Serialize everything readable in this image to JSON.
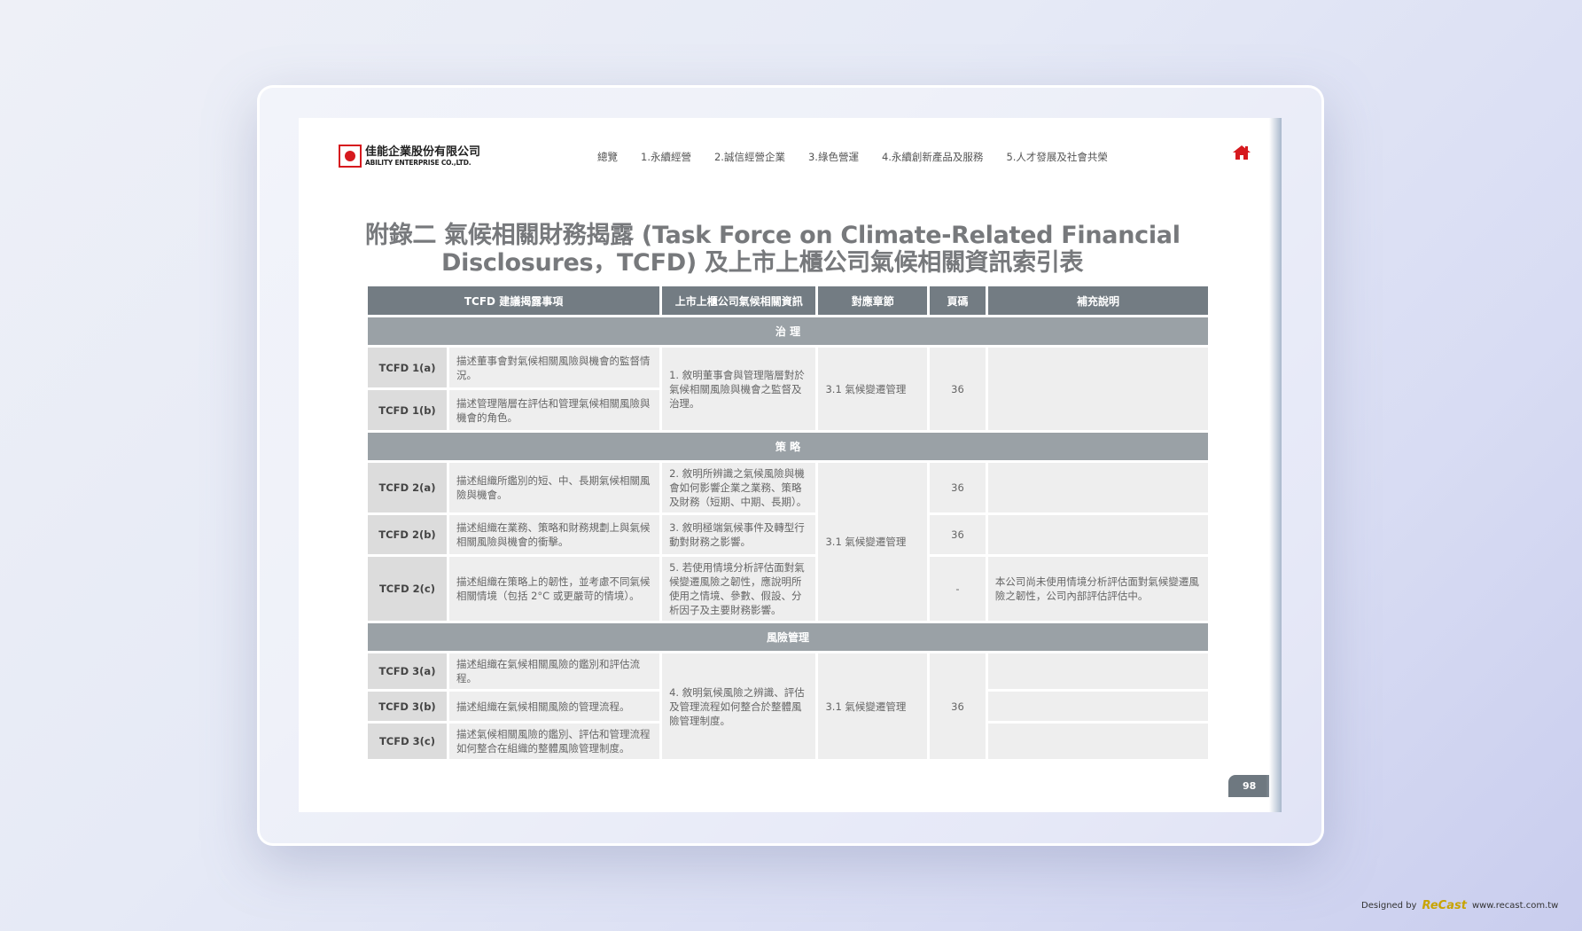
{
  "logo": {
    "cn": "佳能企業股份有限公司",
    "en": "ABILITY ENTERPRISE CO.,LTD."
  },
  "nav": {
    "items": [
      "總覽",
      "1.永續經營",
      "2.誠信經營企業",
      "3.綠色營運",
      "4.永續創新產品及服務",
      "5.人才發展及社會共榮"
    ],
    "active": "附錄",
    "home_icon": "home-icon"
  },
  "title": {
    "line1": "附錄二 氣候相關財務揭露 (Task Force on Climate-Related Financial",
    "line2": "Disclosures，TCFD) 及上市上櫃公司氣候相關資訊索引表"
  },
  "table": {
    "headers": [
      "TCFD 建議揭露事項",
      "上市上櫃公司氣候相關資訊",
      "對應章節",
      "頁碼",
      "補充說明"
    ],
    "sections": [
      {
        "name": "治 理",
        "rows": [
          {
            "code": "TCFD 1(a)",
            "item": "描述董事會對氣候相關風險與機會的監督情況。"
          },
          {
            "code": "TCFD 1(b)",
            "item": "描述管理階層在評估和管理氣候相關風險與機會的角色。"
          }
        ],
        "info": [
          "1. 敘明董事會與管理階層對於氣候相關風險與機會之監督及治理。"
        ],
        "chapter": "3.1 氣候變遷管理",
        "pages": [
          "36"
        ],
        "notes": [
          ""
        ]
      },
      {
        "name": "策 略",
        "rows": [
          {
            "code": "TCFD 2(a)",
            "item": "描述組織所鑑別的短、中、長期氣候相關風險與機會。",
            "info": "2. 敘明所辨識之氣候風險與機會如何影響企業之業務、策略及財務（短期、中期、長期）。",
            "page": "36",
            "note": ""
          },
          {
            "code": "TCFD 2(b)",
            "item": "描述組織在業務、策略和財務規劃上與氣候相關風險與機會的衝擊。",
            "info": "3. 敘明極端氣候事件及轉型行動對財務之影響。",
            "page": "36",
            "note": ""
          },
          {
            "code": "TCFD 2(c)",
            "item": "描述組織在策略上的韌性，並考慮不同氣候相關情境（包括 2°C 或更嚴苛的情境）。",
            "info": "5. 若使用情境分析評估面對氣候變遷風險之韌性，應說明所使用之情境、參數、假設、分析因子及主要財務影響。",
            "page": "-",
            "note": "本公司尚未使用情境分析評估面對氣候變遷風險之韌性，公司內部評估評估中。"
          }
        ],
        "chapter": "3.1 氣候變遷管理"
      },
      {
        "name": "風險管理",
        "rows": [
          {
            "code": "TCFD 3(a)",
            "item": "描述組織在氣候相關風險的鑑別和評估流程。"
          },
          {
            "code": "TCFD 3(b)",
            "item": "描述組織在氣候相關風險的管理流程。"
          },
          {
            "code": "TCFD 3(c)",
            "item": "描述氣候相關風險的鑑別、評估和管理流程如何整合在組織的整體風險管理制度。"
          }
        ],
        "info": [
          "4. 敘明氣候風險之辨識、評估及管理流程如何整合於整體風險管理制度。"
        ],
        "chapter": "3.1 氣候變遷管理",
        "pages": [
          "36"
        ]
      }
    ]
  },
  "page_number": "98",
  "credit": {
    "designed_by": "Designed by",
    "brand": "ReCast",
    "url": "www.recast.com.tw"
  },
  "colors": {
    "header": "#737c83",
    "band": "#9aa1a6",
    "code_cell": "#dcdcdc",
    "cell": "#eeeeee",
    "home": "#d6191e"
  }
}
